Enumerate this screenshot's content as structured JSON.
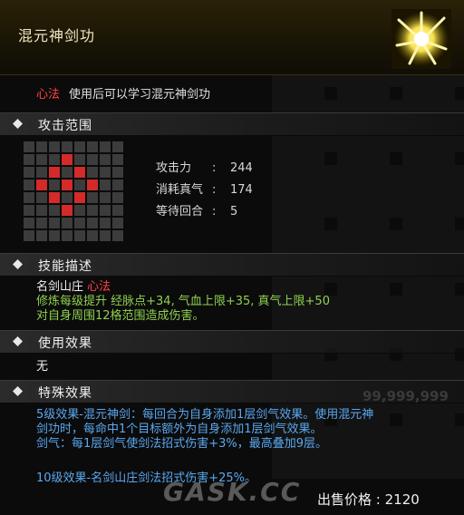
{
  "skill": {
    "title": "混元神剑功",
    "type_tag": "心法",
    "use_desc": "使用后可以学习混元神剑功"
  },
  "sections": {
    "attack_range": "攻击范围",
    "skill_desc": "技能描述",
    "use_effect": "使用效果",
    "special_effect": "特殊效果"
  },
  "range_grid": {
    "size": 8,
    "highlighted": [
      [
        1,
        3
      ],
      [
        2,
        2
      ],
      [
        2,
        4
      ],
      [
        3,
        1
      ],
      [
        3,
        3
      ],
      [
        3,
        5
      ],
      [
        4,
        2
      ],
      [
        4,
        4
      ],
      [
        5,
        3
      ]
    ]
  },
  "stats": [
    {
      "label": "攻击力",
      "sep": ":",
      "value": "244"
    },
    {
      "label": "消耗真气",
      "sep": ":",
      "value": "174"
    },
    {
      "label": "等待回合",
      "sep": ":",
      "value": "5"
    }
  ],
  "description": {
    "sect": "名剑山庄",
    "sect_type": "心法",
    "bonus_line": "修炼每级提升 经脉点+34, 气血上限+35, 真气上限+50",
    "effect_line": "对自身周围12格范围造成伤害。"
  },
  "use_effect_text": "无",
  "special_effects": [
    "5级效果-混元神剑：每回合为自身添加1层剑气效果。使用混元神",
    "剑功时，每命中1个目标额外为自身添加1层剑气效果。",
    "剑气：每1层剑气使剑法招式伤害+3%，最高叠加9层。",
    "",
    "10级效果-名剑山庄剑法招式伤害+25%。"
  ],
  "watermark_number": "99,999,999",
  "site_logo": "GASK.CC",
  "price": {
    "label": "出售价格",
    "sep": ":",
    "value": "2120"
  },
  "colors": {
    "highlight_red": "#d42a2a",
    "bonus_green": "#8fd14f",
    "special_blue": "#5aa8f0",
    "tag_red": "#ff4444"
  }
}
